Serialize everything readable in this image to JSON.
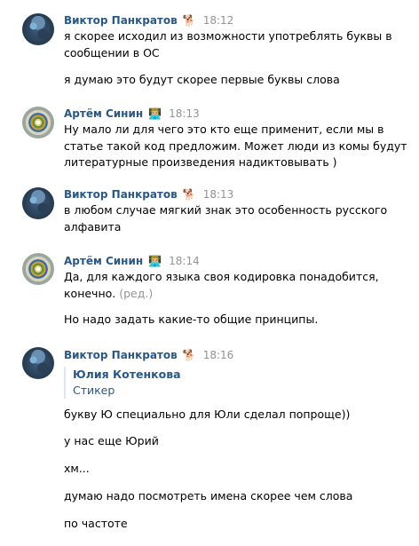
{
  "messages": [
    {
      "author": "Виктор Панкратов",
      "emoji": "🐕",
      "time": "18:12",
      "lines": [
        "я скорее исходил из возможности употреблять буквы в сообщении в ОС",
        "я думаю это будут скорее первые буквы слова"
      ]
    },
    {
      "author": "Артём Синин",
      "emoji": "👨🏼‍💻",
      "time": "18:13",
      "lines": [
        "Ну мало ли для чего это кто еще применит, если мы в статье такой код предложим. Может люди из комы будут литературные произведения надиктовывать )"
      ]
    },
    {
      "author": "Виктор Панкратов",
      "emoji": "🐕",
      "time": "18:13",
      "lines": [
        "в любом случае мягкий знак это особенность русского алфавита"
      ]
    },
    {
      "author": "Артём Синин",
      "emoji": "👨🏼‍💻",
      "time": "18:14",
      "lines": [
        "Да, для каждого языка своя кодировка понадобится, конечно.",
        "Но надо задать какие-то общие принципы."
      ],
      "edited": "(ред.)"
    },
    {
      "author": "Виктор Панкратов",
      "emoji": "🐕",
      "time": "18:16",
      "quote": {
        "name": "Юлия Котенкова",
        "subtitle": "Стикер"
      },
      "lines": [
        "букву Ю специально для Юли сделал попроще))",
        "у нас еще Юрий",
        "хм...",
        "думаю надо посмотреть имена скорее чем слова",
        "по частоте"
      ]
    }
  ]
}
